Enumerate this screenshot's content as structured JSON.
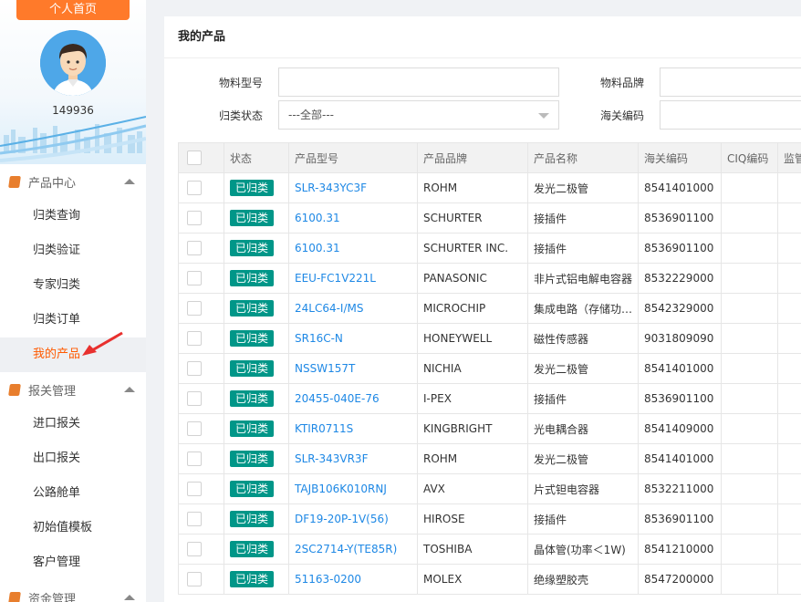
{
  "sidebar": {
    "home_tab": "个人首页",
    "user_id": "149936",
    "groups": [
      {
        "label": "产品中心",
        "items": [
          "归类查询",
          "归类验证",
          "专家归类",
          "归类订单",
          "我的产品"
        ]
      },
      {
        "label": "报关管理",
        "items": [
          "进口报关",
          "出口报关",
          "公路舱单",
          "初始值模板",
          "客户管理"
        ]
      },
      {
        "label": "资金管理",
        "items": []
      }
    ],
    "active_item": "我的产品",
    "accent_color": "#ff5a00"
  },
  "main": {
    "title": "我的产品",
    "filters": {
      "model_label": "物料型号",
      "brand_label": "物料品牌",
      "status_label": "归类状态",
      "status_value": "---全部---",
      "hs_label": "海关编码"
    },
    "table": {
      "headers": [
        "状态",
        "产品型号",
        "产品品牌",
        "产品名称",
        "海关编码",
        "CIQ编码",
        "监管"
      ],
      "rows": [
        {
          "status": "已归类",
          "model": "SLR-343YC3F",
          "brand": "ROHM",
          "name": "发光二极管",
          "hs": "8541401000"
        },
        {
          "status": "已归类",
          "model": "6100.31",
          "brand": "SCHURTER",
          "name": "接插件",
          "hs": "8536901100"
        },
        {
          "status": "已归类",
          "model": "6100.31",
          "brand": "SCHURTER INC.",
          "name": "接插件",
          "hs": "8536901100"
        },
        {
          "status": "已归类",
          "model": "EEU-FC1V221L",
          "brand": "PANASONIC",
          "name": "非片式铝电解电容器",
          "hs": "8532229000"
        },
        {
          "status": "已归类",
          "model": "24LC64-I/MS",
          "brand": "MICROCHIP",
          "name": "集成电路（存储功…",
          "hs": "8542329000"
        },
        {
          "status": "已归类",
          "model": "SR16C-N",
          "brand": "HONEYWELL",
          "name": "磁性传感器",
          "hs": "9031809090"
        },
        {
          "status": "已归类",
          "model": "NSSW157T",
          "brand": "NICHIA",
          "name": "发光二极管",
          "hs": "8541401000"
        },
        {
          "status": "已归类",
          "model": "20455-040E-76",
          "brand": "I-PEX",
          "name": "接插件",
          "hs": "8536901100"
        },
        {
          "status": "已归类",
          "model": "KTIR0711S",
          "brand": "KINGBRIGHT",
          "name": "光电耦合器",
          "hs": "8541409000"
        },
        {
          "status": "已归类",
          "model": "SLR-343VR3F",
          "brand": "ROHM",
          "name": "发光二极管",
          "hs": "8541401000"
        },
        {
          "status": "已归类",
          "model": "TAJB106K010RNJ",
          "brand": "AVX",
          "name": "片式钽电容器",
          "hs": "8532211000"
        },
        {
          "status": "已归类",
          "model": "DF19-20P-1V(56)",
          "brand": "HIROSE",
          "name": "接插件",
          "hs": "8536901100"
        },
        {
          "status": "已归类",
          "model": "2SC2714-Y(TE85R)",
          "brand": "TOSHIBA",
          "name": "晶体管(功率＜1W)",
          "hs": "8541210000"
        },
        {
          "status": "已归类",
          "model": "51163-0200",
          "brand": "MOLEX",
          "name": "绝缘塑胶壳",
          "hs": "8547200000"
        }
      ]
    }
  }
}
